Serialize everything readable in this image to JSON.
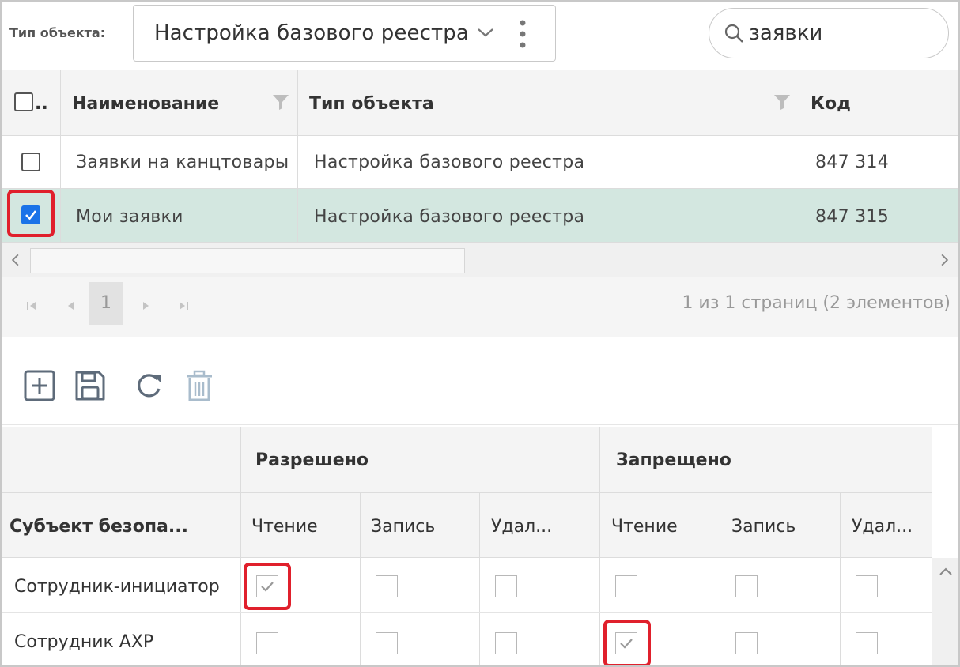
{
  "header": {
    "type_label": "Тип объекта:",
    "type_value": "Настройка базового реестра",
    "search_value": "заявки"
  },
  "grid": {
    "select_all_label": "..",
    "columns": [
      "Наименование",
      "Тип объекта",
      "Код"
    ],
    "rows": [
      {
        "checked": false,
        "name": "Заявки на канцтовары",
        "type": "Настройка базового реестра",
        "code": "847 314"
      },
      {
        "checked": true,
        "name": "Мои заявки",
        "type": "Настройка базового реестра",
        "code": "847 315"
      }
    ]
  },
  "pager": {
    "current_page": "1",
    "info": "1 из 1 страниц (2 элементов)"
  },
  "permissions": {
    "groups": [
      "Разрешено",
      "Запрещено"
    ],
    "subject_header": "Субъект безопа...",
    "sub_columns": [
      "Чтение",
      "Запись",
      "Удал...",
      "Чтение",
      "Запись",
      "Удал..."
    ],
    "rows": [
      {
        "subject": "Сотрудник-инициатор",
        "values": [
          true,
          false,
          false,
          false,
          false,
          false
        ]
      },
      {
        "subject": "Сотрудник АХР",
        "values": [
          false,
          false,
          false,
          true,
          false,
          false
        ]
      }
    ]
  },
  "colors": {
    "selected_row": "#d3e7e0",
    "highlight": "#e0202c",
    "checkbox_checked": "#1a73e8"
  },
  "icons": [
    "chevron-down-icon",
    "more-vertical-icon",
    "search-icon",
    "filter-icon",
    "add-icon",
    "save-icon",
    "refresh-icon",
    "delete-icon"
  ]
}
